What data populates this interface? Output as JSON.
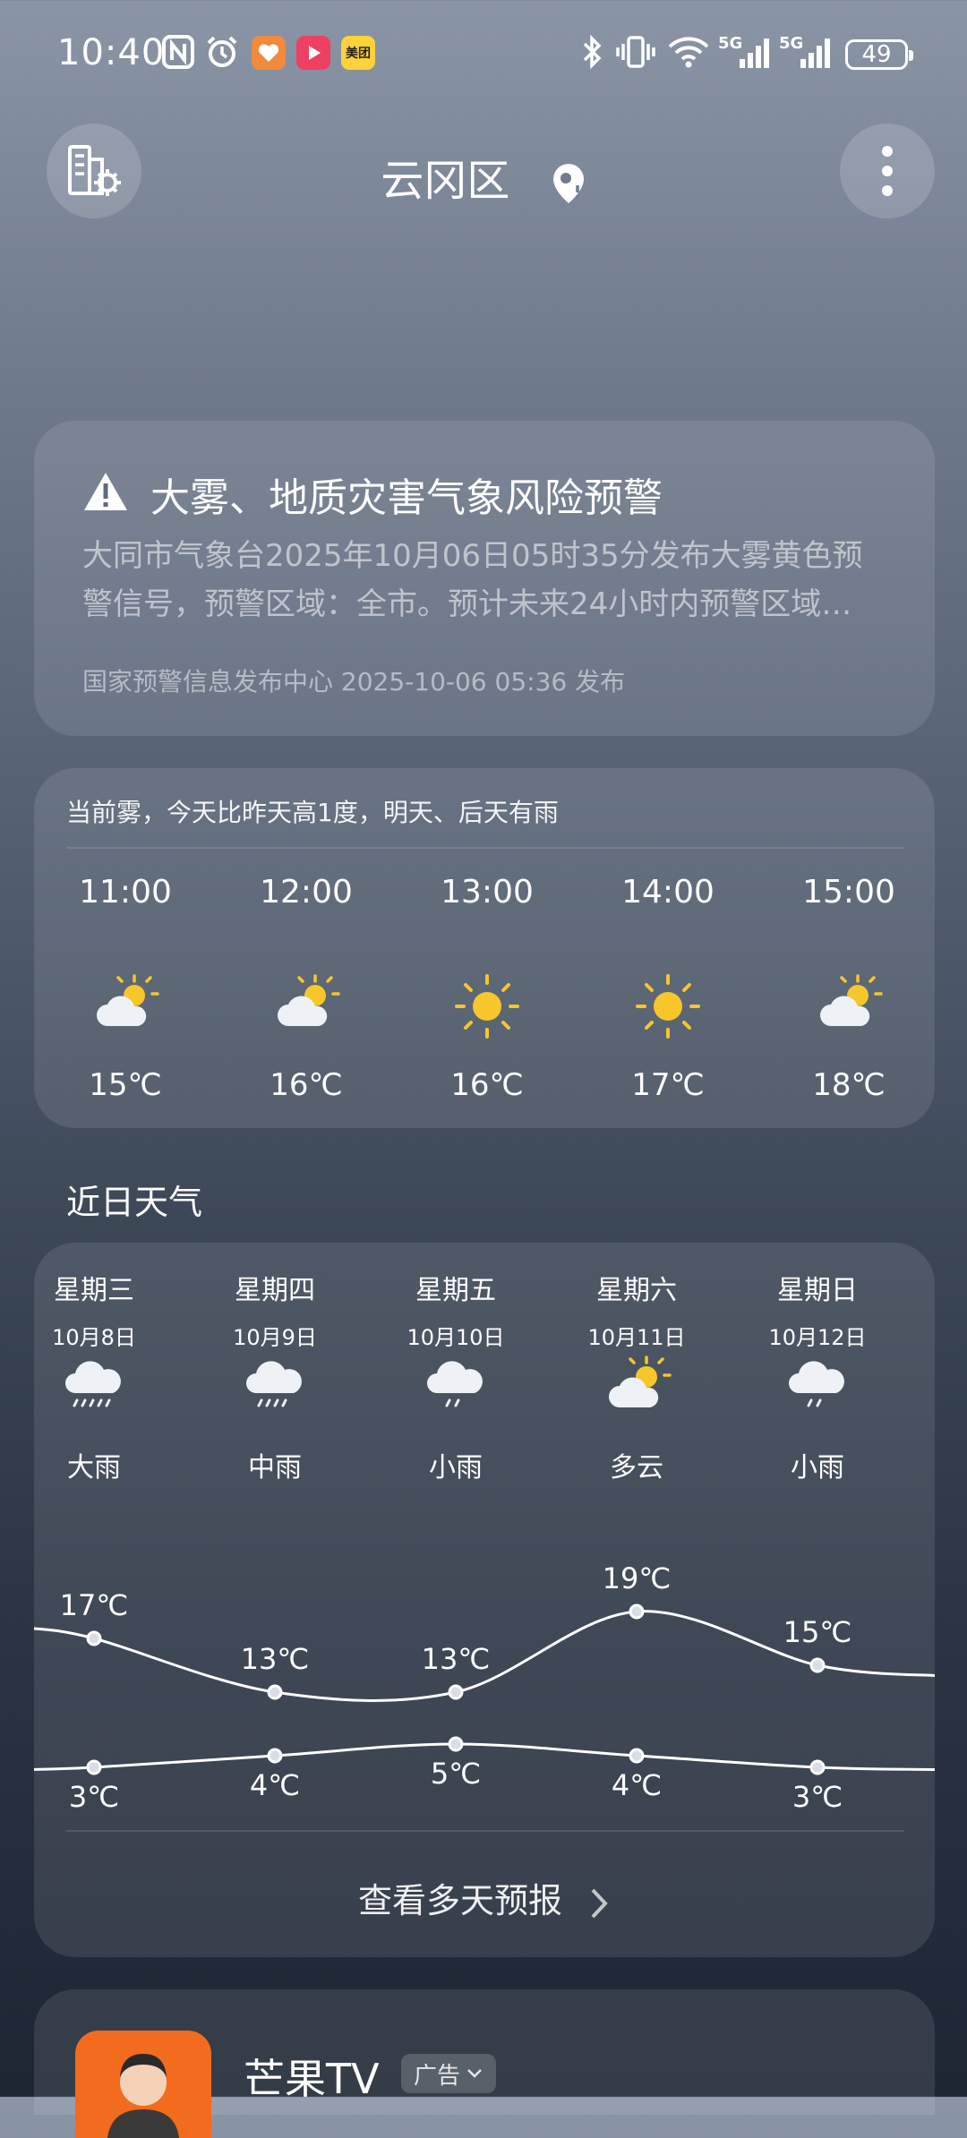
{
  "status_bar": {
    "time": "10:40",
    "battery": "49",
    "network1": "5G",
    "network2": "5G",
    "meituan_label": "美团"
  },
  "header": {
    "location": "云冈区"
  },
  "alert": {
    "title": "大雾、地质灾害气象风险预警",
    "body_line1": "大同市气象台2025年10月06日05时35分发布大雾黄色预",
    "body_line2": "警信号，预警区域：全市。预计未来24小时内预警区域…",
    "source": "国家预警信息发布中心 2025-10-06 05:36 发布"
  },
  "hourly": {
    "summary": "当前雾，今天比昨天高1度，明天、后天有雨",
    "items": [
      {
        "time": "11:00",
        "temp": "15℃",
        "icon": "partly-cloudy-icon"
      },
      {
        "time": "12:00",
        "temp": "16℃",
        "icon": "partly-cloudy-icon"
      },
      {
        "time": "13:00",
        "temp": "16℃",
        "icon": "sunny-icon"
      },
      {
        "time": "14:00",
        "temp": "17℃",
        "icon": "sunny-icon"
      },
      {
        "time": "15:00",
        "temp": "18℃",
        "icon": "partly-cloudy-icon"
      }
    ]
  },
  "daily": {
    "title": "近日天气",
    "days": [
      {
        "weekday": "星期三",
        "date": "10月8日",
        "condition": "大雨",
        "icon": "heavy-rain-icon",
        "high": 17,
        "low": 3,
        "high_label": "17℃",
        "low_label": "3℃"
      },
      {
        "weekday": "星期四",
        "date": "10月9日",
        "condition": "中雨",
        "icon": "moderate-rain-icon",
        "high": 13,
        "low": 4,
        "high_label": "13℃",
        "low_label": "4℃"
      },
      {
        "weekday": "星期五",
        "date": "10月10日",
        "condition": "小雨",
        "icon": "light-rain-icon",
        "high": 13,
        "low": 5,
        "high_label": "13℃",
        "low_label": "5℃"
      },
      {
        "weekday": "星期六",
        "date": "10月11日",
        "condition": "多云",
        "icon": "partly-cloudy-icon",
        "high": 19,
        "low": 4,
        "high_label": "19℃",
        "low_label": "4℃"
      },
      {
        "weekday": "星期日",
        "date": "10月12日",
        "condition": "小雨",
        "icon": "light-rain-icon",
        "high": 15,
        "low": 3,
        "high_label": "15℃",
        "low_label": "3℃"
      }
    ],
    "more_label": "查看多天预报"
  },
  "ad": {
    "name": "芒果TV",
    "tag": "广告"
  },
  "colors": {
    "sun": "#f6c62b",
    "cloud": "#eef1f5",
    "logo_orange": "#f36b1c"
  }
}
